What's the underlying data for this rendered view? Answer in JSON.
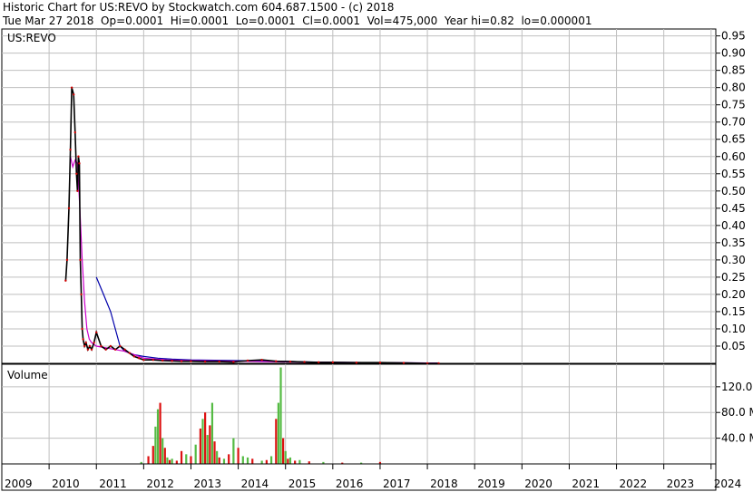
{
  "header": {
    "line1": "Historic Chart for US:REVO by Stockwatch.com 604.687.1500 - (c) 2018",
    "line2": "Tue Mar 27 2018  Op=0.0001  Hi=0.0001  Lo=0.0001  Cl=0.0001  Vol=475,000  Year hi=0.82  lo=0.000001"
  },
  "colors": {
    "grid": "#bfbfbf",
    "price": "#000000",
    "down_marker": "#cc0000",
    "ma_short": "#cc00cc",
    "ma_long": "#0000aa",
    "vol_up": "#55bb44",
    "vol_down": "#dd1111"
  },
  "chart_data": [
    {
      "type": "line",
      "title": "US:REVO",
      "y_tick_labels": [
        "0.95",
        "0.90",
        "0.85",
        "0.80",
        "0.75",
        "0.70",
        "0.65",
        "0.60",
        "0.55",
        "0.50",
        "0.45",
        "0.40",
        "0.35",
        "0.30",
        "0.25",
        "0.20",
        "0.15",
        "0.10",
        "0.05"
      ],
      "ylim": [
        0,
        0.97
      ],
      "x_tick_labels": [
        "2009",
        "2010",
        "2011",
        "2012",
        "2013",
        "2014",
        "2015",
        "2016",
        "2017",
        "2018",
        "2019",
        "2020",
        "2021",
        "2022",
        "2023",
        "2024"
      ],
      "xlim": [
        2009.0,
        2024.1
      ],
      "series": [
        {
          "role": "price",
          "x": [
            2010.35,
            2010.38,
            2010.42,
            2010.45,
            2010.48,
            2010.52,
            2010.55,
            2010.58,
            2010.6,
            2010.62,
            2010.64,
            2010.66,
            2010.68,
            2010.7,
            2010.72,
            2010.75,
            2010.78,
            2010.82,
            2010.86,
            2010.9,
            2010.95,
            2011.0,
            2011.1,
            2011.2,
            2011.3,
            2011.4,
            2011.5,
            2011.6,
            2011.7,
            2011.8,
            2011.9,
            2012.0,
            2012.2,
            2012.4,
            2012.6,
            2012.8,
            2013.0,
            2013.3,
            2013.6,
            2013.9,
            2014.2,
            2014.5,
            2014.8,
            2015.1,
            2015.4,
            2015.7,
            2016.0,
            2016.5,
            2017.0,
            2017.5,
            2018.0,
            2018.24
          ],
          "y": [
            0.24,
            0.3,
            0.45,
            0.62,
            0.8,
            0.78,
            0.67,
            0.55,
            0.5,
            0.6,
            0.58,
            0.3,
            0.2,
            0.1,
            0.07,
            0.05,
            0.06,
            0.04,
            0.05,
            0.04,
            0.06,
            0.09,
            0.05,
            0.04,
            0.05,
            0.04,
            0.05,
            0.04,
            0.03,
            0.02,
            0.015,
            0.01,
            0.01,
            0.008,
            0.007,
            0.006,
            0.006,
            0.005,
            0.005,
            0.004,
            0.008,
            0.01,
            0.006,
            0.005,
            0.004,
            0.003,
            0.003,
            0.002,
            0.002,
            0.001,
            0.0001,
            0.0001
          ]
        },
        {
          "role": "moving-average-short",
          "x": [
            2010.45,
            2010.5,
            2010.55,
            2010.6,
            2010.65,
            2010.7,
            2010.75,
            2010.8,
            2010.85,
            2010.9,
            2011.0,
            2011.2,
            2011.4,
            2011.6,
            2011.8,
            2012.0,
            2012.5,
            2013.0,
            2014.0,
            2015.0,
            2016.0,
            2017.0,
            2018.0,
            2018.24
          ],
          "y": [
            0.6,
            0.57,
            0.59,
            0.58,
            0.45,
            0.3,
            0.18,
            0.1,
            0.07,
            0.06,
            0.05,
            0.045,
            0.04,
            0.035,
            0.025,
            0.015,
            0.01,
            0.008,
            0.006,
            0.004,
            0.003,
            0.002,
            0.001,
            0.0005
          ]
        },
        {
          "role": "moving-average-long",
          "x": [
            2011.0,
            2011.15,
            2011.3,
            2011.4,
            2011.5,
            2011.6,
            2011.8,
            2012.0,
            2012.3,
            2012.6,
            2013.0,
            2013.5,
            2014.0,
            2014.5,
            2015.0,
            2015.5,
            2016.0,
            2017.0,
            2018.0,
            2018.24
          ],
          "y": [
            0.25,
            0.2,
            0.15,
            0.1,
            0.05,
            0.035,
            0.025,
            0.02,
            0.015,
            0.012,
            0.01,
            0.009,
            0.008,
            0.007,
            0.006,
            0.004,
            0.003,
            0.002,
            0.001,
            0.0008
          ]
        }
      ]
    },
    {
      "type": "bar",
      "title": "Volume",
      "y_tick_labels": [
        "120.0 M",
        "80.0 M",
        "40.0 M"
      ],
      "ylim": [
        0,
        155
      ],
      "x_tick_labels": [
        "2009",
        "2010",
        "2011",
        "2012",
        "2013",
        "2014",
        "2015",
        "2016",
        "2017",
        "2018",
        "2019",
        "2020",
        "2021",
        "2022",
        "2023",
        "2024"
      ],
      "xlim": [
        2009.0,
        2024.1
      ],
      "x": [
        2011.95,
        2012.1,
        2012.2,
        2012.25,
        2012.3,
        2012.35,
        2012.4,
        2012.45,
        2012.5,
        2012.55,
        2012.6,
        2012.7,
        2012.8,
        2012.9,
        2013.0,
        2013.1,
        2013.2,
        2013.25,
        2013.3,
        2013.35,
        2013.4,
        2013.45,
        2013.5,
        2013.55,
        2013.6,
        2013.7,
        2013.8,
        2013.9,
        2014.0,
        2014.1,
        2014.2,
        2014.3,
        2014.5,
        2014.6,
        2014.7,
        2014.8,
        2014.85,
        2014.9,
        2014.95,
        2015.0,
        2015.05,
        2015.1,
        2015.2,
        2015.3,
        2015.5,
        2015.8,
        2016.2,
        2016.6,
        2017.0
      ],
      "values": [
        3,
        12,
        28,
        58,
        85,
        95,
        40,
        25,
        10,
        6,
        8,
        5,
        20,
        15,
        12,
        30,
        55,
        70,
        80,
        45,
        60,
        95,
        35,
        20,
        10,
        8,
        15,
        40,
        25,
        12,
        10,
        8,
        5,
        6,
        12,
        70,
        95,
        150,
        40,
        20,
        8,
        10,
        5,
        6,
        4,
        3,
        2,
        2,
        3
      ],
      "direction": [
        "u",
        "d",
        "d",
        "u",
        "u",
        "d",
        "u",
        "d",
        "u",
        "d",
        "u",
        "d",
        "d",
        "u",
        "d",
        "u",
        "d",
        "u",
        "d",
        "u",
        "d",
        "u",
        "d",
        "u",
        "d",
        "u",
        "d",
        "u",
        "d",
        "u",
        "u",
        "d",
        "u",
        "d",
        "u",
        "d",
        "u",
        "u",
        "d",
        "u",
        "d",
        "u",
        "d",
        "u",
        "d",
        "u",
        "d",
        "u",
        "d"
      ]
    }
  ]
}
